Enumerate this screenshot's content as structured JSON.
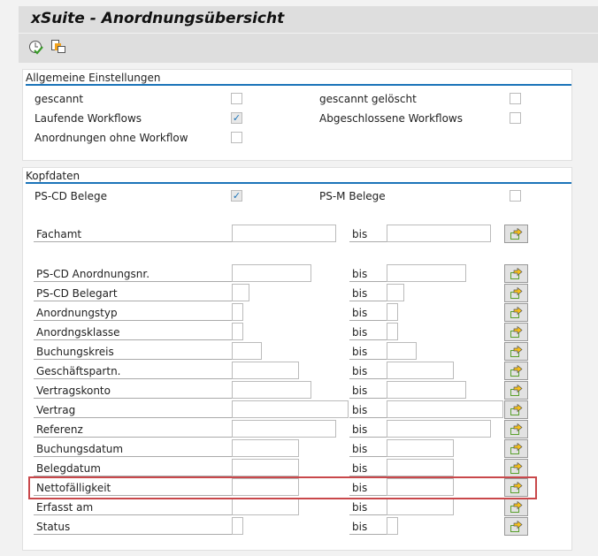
{
  "title": "xSuite - Anordnungsübersicht",
  "toolbar": {
    "icons": [
      "execute-clock-icon",
      "copy-variant-icon"
    ]
  },
  "allgemein": {
    "header": "Allgemeine Einstellungen",
    "gescannt": {
      "label": "gescannt",
      "checked": false
    },
    "gescannt_geloescht": {
      "label": "gescannt gelöscht",
      "checked": false
    },
    "laufende": {
      "label": "Laufende Workflows",
      "checked": true
    },
    "abgeschlossene": {
      "label": "Abgeschlossene Workflows",
      "checked": false
    },
    "ohne_wf": {
      "label": "Anordnungen ohne Workflow",
      "checked": false
    }
  },
  "kopfdaten": {
    "header": "Kopfdaten",
    "pscd": {
      "label": "PS-CD Belege",
      "checked": true
    },
    "psm": {
      "label": "PS-M Belege",
      "checked": false
    },
    "bis_label": "bis",
    "fields": [
      {
        "label": "Fachamt",
        "from": "",
        "to": ""
      },
      {
        "label": "PS-CD Anordnungsnr.",
        "from": "",
        "to": ""
      },
      {
        "label": "PS-CD Belegart",
        "from": "",
        "to": ""
      },
      {
        "label": "Anordnungstyp",
        "from": "",
        "to": ""
      },
      {
        "label": "Anordngsklasse",
        "from": "",
        "to": ""
      },
      {
        "label": "Buchungskreis",
        "from": "",
        "to": ""
      },
      {
        "label": "Geschäftspartn.",
        "from": "",
        "to": ""
      },
      {
        "label": "Vertragskonto",
        "from": "",
        "to": ""
      },
      {
        "label": "Vertrag",
        "from": "",
        "to": ""
      },
      {
        "label": "Referenz",
        "from": "",
        "to": ""
      },
      {
        "label": "Buchungsdatum",
        "from": "",
        "to": ""
      },
      {
        "label": "Belegdatum",
        "from": "",
        "to": ""
      },
      {
        "label": "Nettofälligkeit",
        "from": "",
        "to": "",
        "highlighted": true
      },
      {
        "label": "Erfasst am",
        "from": "",
        "to": ""
      },
      {
        "label": "Status",
        "from": "",
        "to": ""
      }
    ]
  },
  "colors": {
    "accent": "#1b74b9",
    "highlight": "#c9484b"
  }
}
